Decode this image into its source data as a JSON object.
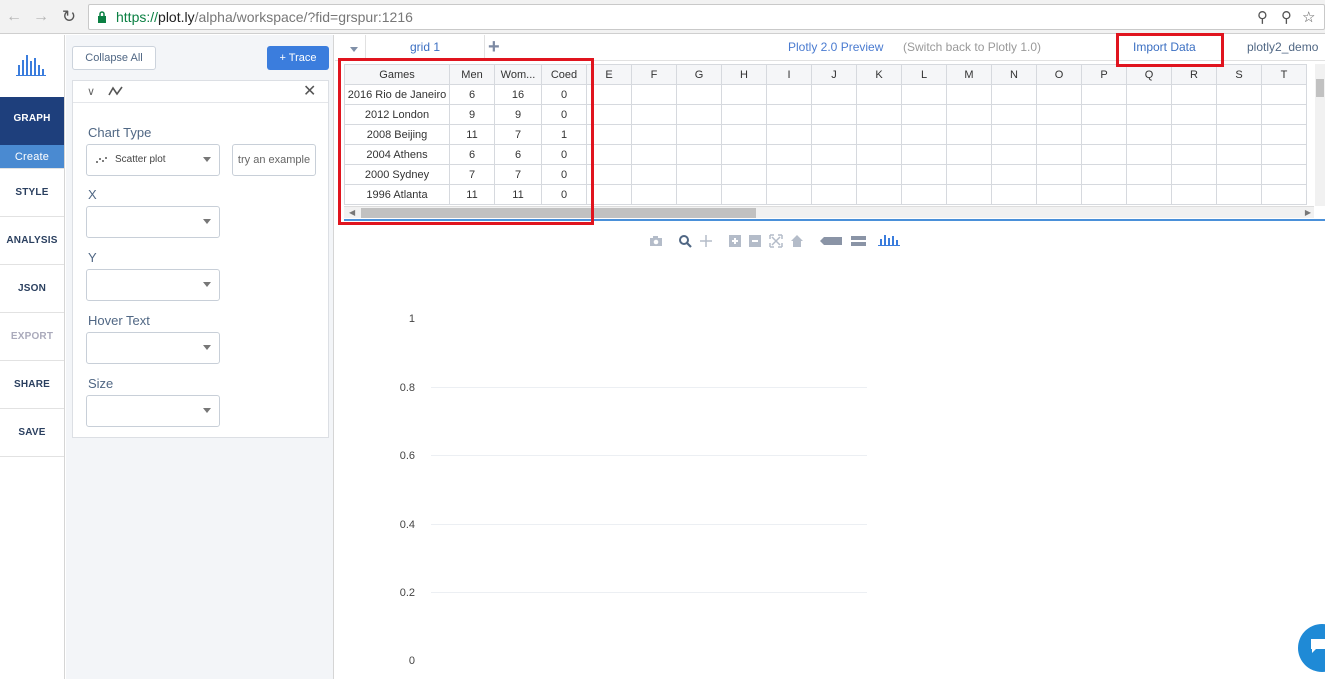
{
  "browser": {
    "url_scheme": "https://",
    "url_host": "plot.ly",
    "url_path": "/alpha/workspace/?fid=grspur:1216"
  },
  "leftnav": {
    "items": [
      {
        "label": "GRAPH",
        "active": true
      },
      {
        "label": "Create",
        "sub": true
      },
      {
        "label": "STYLE"
      },
      {
        "label": "ANALYSIS"
      },
      {
        "label": "JSON"
      },
      {
        "label": "EXPORT",
        "disabled": true
      },
      {
        "label": "SHARE"
      },
      {
        "label": "SAVE"
      }
    ]
  },
  "panel": {
    "collapse_label": "Collapse All",
    "trace_label": "+ Trace",
    "chart_type_label": "Chart Type",
    "chart_type_value": "Scatter plot",
    "example_label": "try an example",
    "fields": [
      {
        "label": "X"
      },
      {
        "label": "Y"
      },
      {
        "label": "Hover Text"
      },
      {
        "label": "Size"
      }
    ]
  },
  "gridbar": {
    "tab_label": "grid 1",
    "preview_label": "Plotly 2.0 Preview",
    "switchback_label": "(Switch back to Plotly 1.0)",
    "import_label": "Import Data",
    "user_label": "plotly2_demo"
  },
  "grid": {
    "headers": [
      "Games",
      "Men",
      "Wom...",
      "Coed",
      "E",
      "F",
      "G",
      "H",
      "I",
      "J",
      "K",
      "L",
      "M",
      "N",
      "O",
      "P",
      "Q",
      "R",
      "S",
      "T"
    ],
    "rows": [
      [
        "2016 Rio de Janeiro",
        "6",
        "16",
        "0"
      ],
      [
        "2012 London",
        "9",
        "9",
        "0"
      ],
      [
        "2008 Beijing",
        "11",
        "7",
        "1"
      ],
      [
        "2004 Athens",
        "6",
        "6",
        "0"
      ],
      [
        "2000 Sydney",
        "7",
        "7",
        "0"
      ],
      [
        "1996 Atlanta",
        "11",
        "11",
        "0"
      ]
    ]
  },
  "plot": {
    "yticks": [
      "1",
      "0.8",
      "0.6",
      "0.4",
      "0.2",
      "0"
    ]
  },
  "colors": {
    "accent": "#3b7ddd",
    "nav_active": "#1e3f7c",
    "highlight": "#e0141e"
  }
}
